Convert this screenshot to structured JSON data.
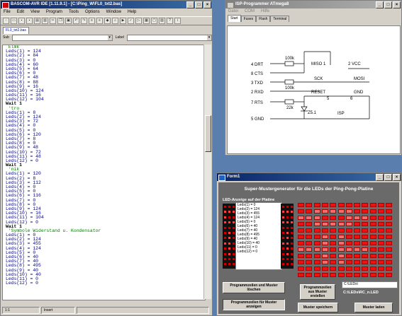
{
  "bascom": {
    "title": "BASCOM-AVR IDE [1.11.9.1] - [C:\\Ping_W\\FL0_txt2.bas]",
    "menu": [
      "File",
      "Edit",
      "View",
      "Program",
      "Tools",
      "Options",
      "Window",
      "Help"
    ],
    "tab": "FL0_txt2.bas",
    "sub_label": "Sub",
    "label_label": "Label",
    "code": [
      {
        "t": " Elmk",
        "c": "cm"
      },
      {
        "t": "Leds(1) = 124"
      },
      {
        "t": "Leds(2) = 84"
      },
      {
        "t": "Leds(3) = 0"
      },
      {
        "t": "Leds(4) = 60"
      },
      {
        "t": "Leds(5) = 64"
      },
      {
        "t": "Leds(6) = 0"
      },
      {
        "t": "Leds(7) = 48"
      },
      {
        "t": "Leds(8) = 88"
      },
      {
        "t": "Leds(9) = 16"
      },
      {
        "t": "Leds(10) = 124"
      },
      {
        "t": "Leds(11) = 16"
      },
      {
        "t": "Leds(12) = 104"
      },
      {
        "t": "Wait 1",
        "c": "kw"
      },
      {
        "t": " 'tro",
        "c": "cm"
      },
      {
        "t": "Leds(1) = 8"
      },
      {
        "t": "Leds(2) = 124"
      },
      {
        "t": "Leds(3) = 72"
      },
      {
        "t": "Leds(4) = 0"
      },
      {
        "t": "Leds(5) = 0"
      },
      {
        "t": "Leds(6) = 120"
      },
      {
        "t": "Leds(7) = 8"
      },
      {
        "t": "Leds(8) = 0"
      },
      {
        "t": "Leds(9) = 48"
      },
      {
        "t": "Leds(10) = 72"
      },
      {
        "t": "Leds(11) = 48"
      },
      {
        "t": "Leds(12) = 0"
      },
      {
        "t": "Wait 1",
        "c": "kw"
      },
      {
        "t": " 'nik",
        "c": "cm"
      },
      {
        "t": "Leds(1) = 120"
      },
      {
        "t": "Leds(2) = 8"
      },
      {
        "t": "Leds(3) = 112"
      },
      {
        "t": "Leds(4) = 0"
      },
      {
        "t": "Leds(5) = 0"
      },
      {
        "t": "Leds(6) = 116"
      },
      {
        "t": "Leds(7) = 0"
      },
      {
        "t": "Leds(8) = 0"
      },
      {
        "t": "Leds(9) = 124"
      },
      {
        "t": "Leds(10) = 16"
      },
      {
        "t": "Leds(11) = 104"
      },
      {
        "t": "Leds(12) = 0"
      },
      {
        "t": "Wait 1",
        "c": "kw"
      },
      {
        "t": " 'Symbole Widerstand u. Kondensator",
        "c": "cm"
      },
      {
        "t": "Leds(1) = 0"
      },
      {
        "t": "Leds(2) = 124"
      },
      {
        "t": "Leds(3) = 455"
      },
      {
        "t": "Leds(4) = 124"
      },
      {
        "t": "Leds(5) = 0"
      },
      {
        "t": "Leds(6) = 40"
      },
      {
        "t": "Leds(7) = 40"
      },
      {
        "t": "Leds(8) = 495"
      },
      {
        "t": "Leds(9) = 40"
      },
      {
        "t": "Leds(10) = 40"
      },
      {
        "t": "Leds(11) = 0"
      },
      {
        "t": "Leds(12) = 0"
      }
    ],
    "status": {
      "pos": "1:1",
      "mode": "Insert"
    }
  },
  "isp": {
    "title": "ISP-Programmer ATmega8",
    "menu": [
      "Datei",
      "COM",
      "Hilfe"
    ],
    "tabs": [
      "Start",
      "Fuses",
      "Flash",
      "Terminal"
    ],
    "pins_left": [
      "4  DRT",
      "8  CTS",
      "3  TXD",
      "2  RXD",
      "7  RTS",
      "5  GND"
    ],
    "resistors": [
      "100k",
      "100k",
      "22k"
    ],
    "diode": "Z5.1",
    "labels": {
      "miso": "MISO  1",
      "vcc": "2  VCC",
      "sck": "SCK",
      "mosi": "MOSI",
      "reset": "RESET",
      "reset_pin": "5",
      "gnd": "GND",
      "gnd_pin": "6",
      "isp": "ISP"
    }
  },
  "form1": {
    "title": "Form1",
    "heading": "Super-Mustergenerator für die LEDs der Ping-Pong-Platine",
    "led_panel_label": "LED-Anzeige auf der Platine",
    "list": [
      "Leds(1) = 0",
      "Leds(2) = 124",
      "Leds(3) = 455",
      "Leds(4) = 124",
      "Leds(5) = 0",
      "Leds(6) = 40",
      "Leds(7) = 40",
      "Leds(8) = 495",
      "Leds(9) = 40",
      "Leds(10) = 40",
      "Leds(11) = 0",
      "Leds(12) = 0"
    ],
    "buttons": {
      "clear": "Programmzeilen und Muster löschen",
      "gen": "Programmzeilen aus Muster erstellen",
      "show": "Programmzeilen für Muster anzeigen",
      "save": "Muster speichern",
      "load": "Muster laden"
    },
    "path1": "C:\\LEDs\\",
    "path2": "C:\\LEDs\\RC_n.LED",
    "led_values": [
      0,
      124,
      455,
      124,
      0,
      40,
      40,
      495,
      40,
      40,
      0,
      0
    ]
  }
}
